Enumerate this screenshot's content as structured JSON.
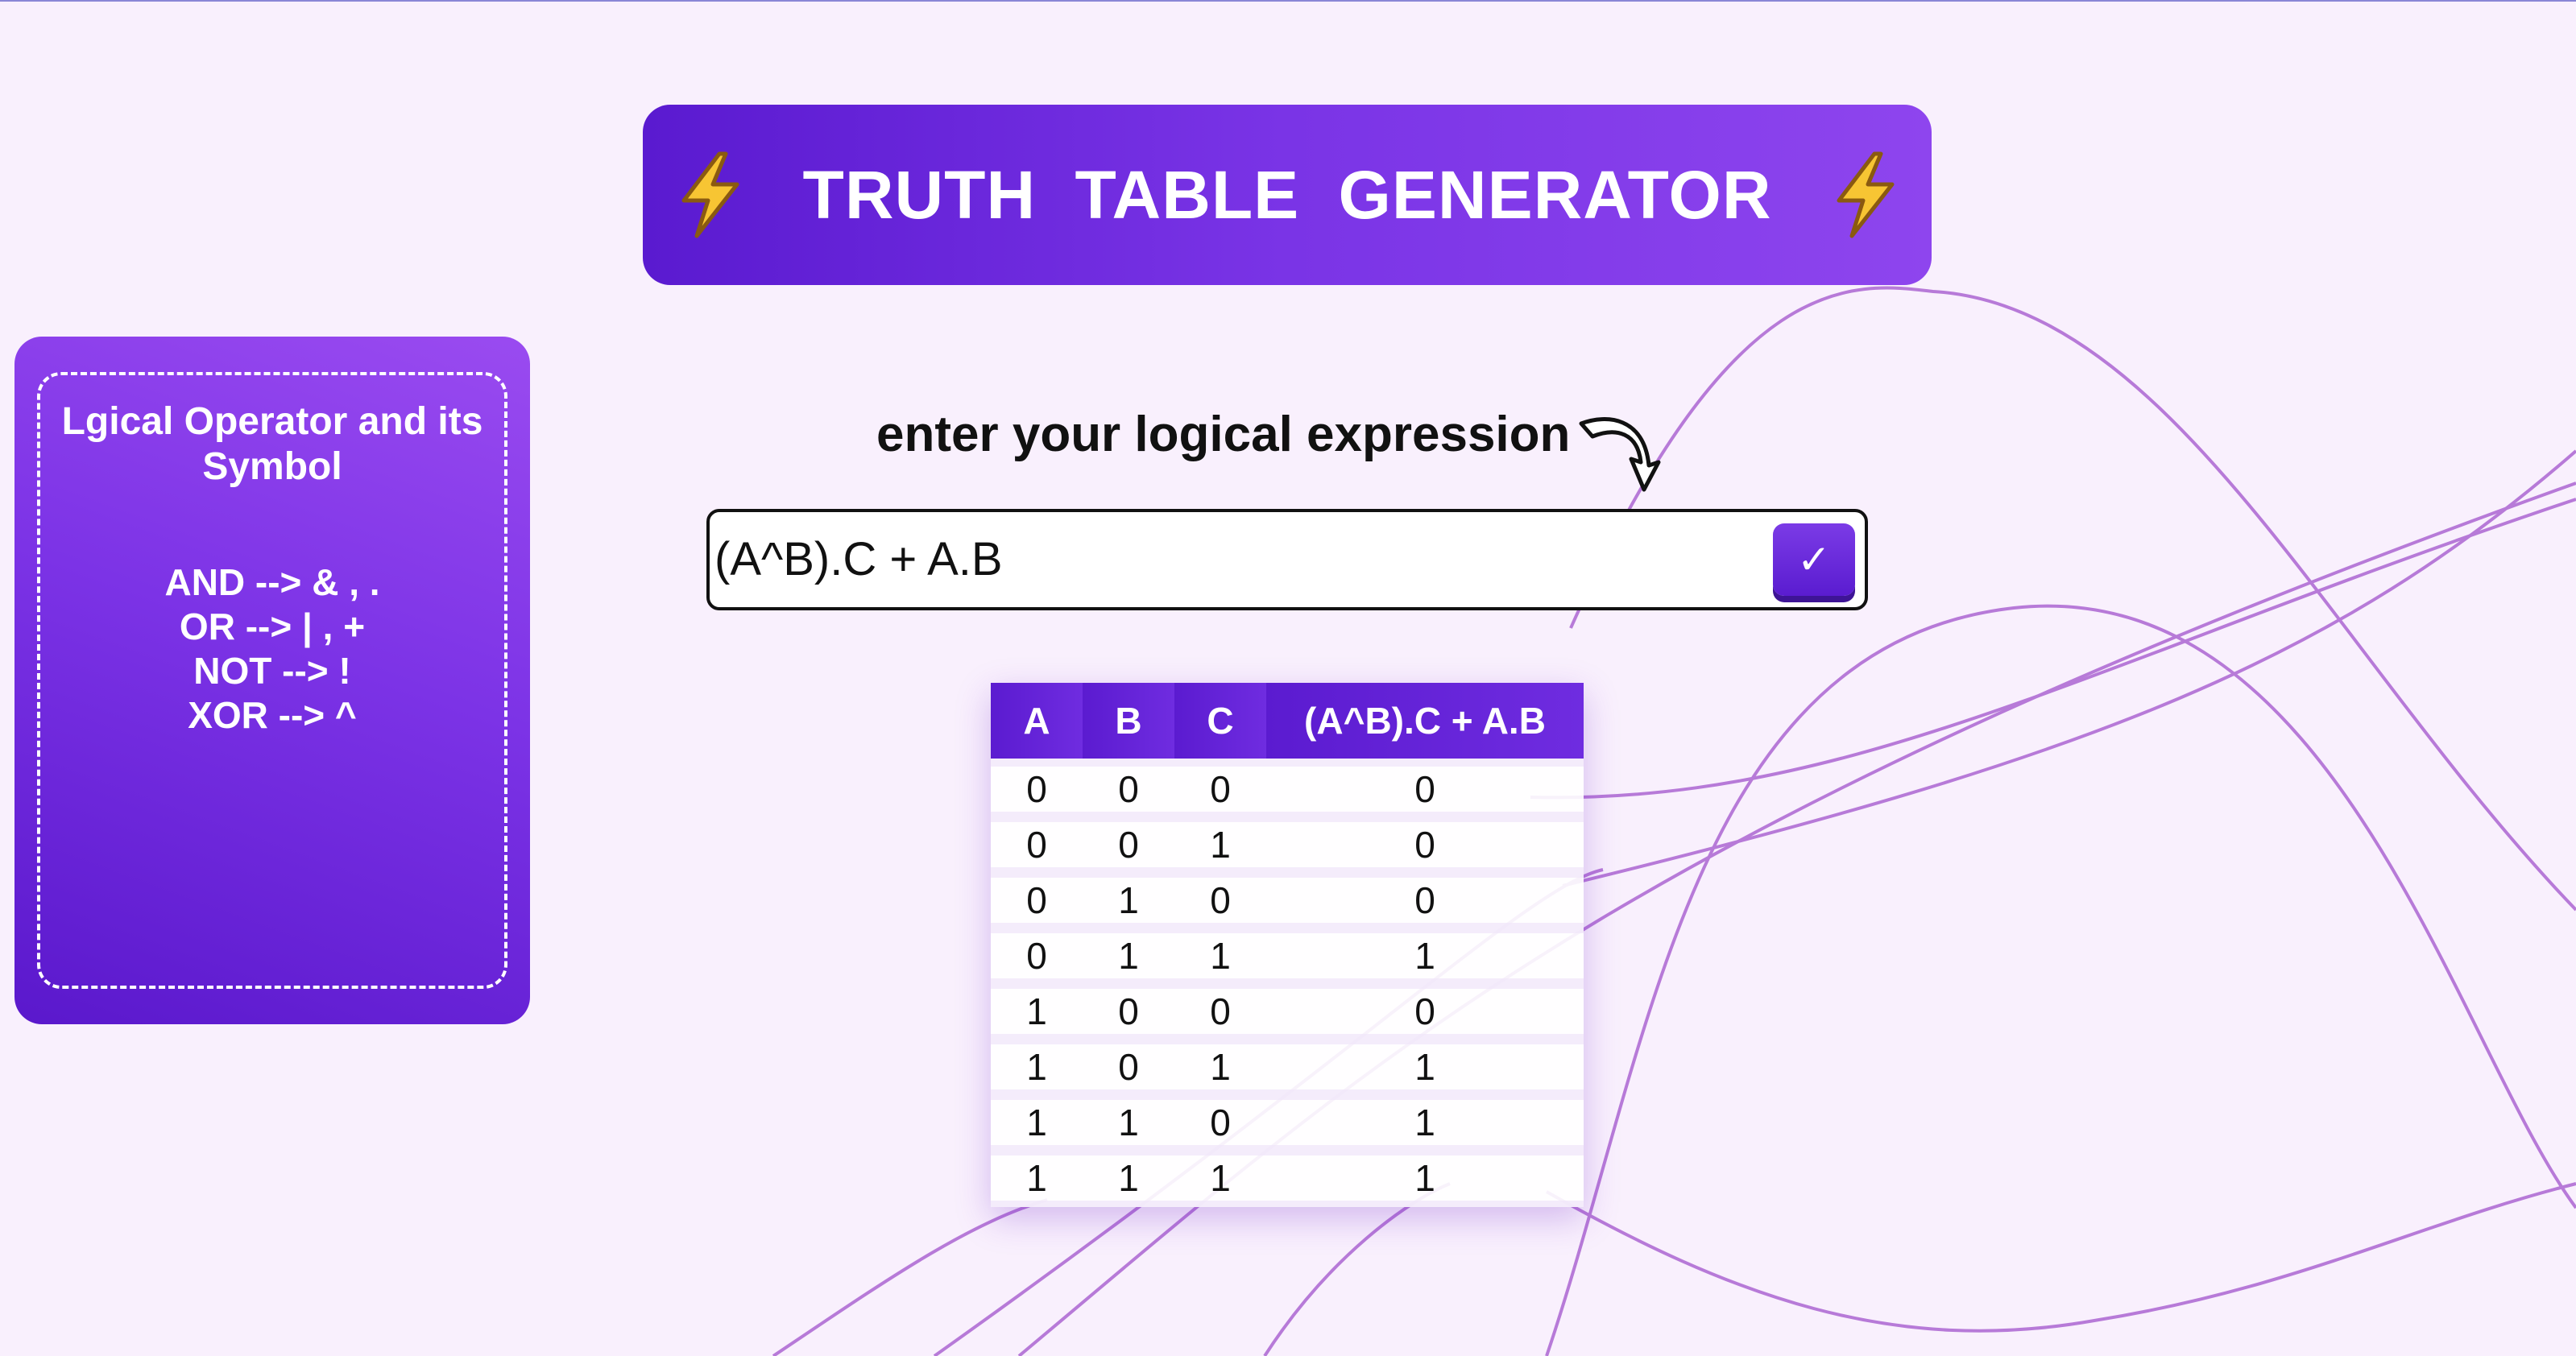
{
  "app": {
    "title": "TRUTH  TABLE  GENERATOR",
    "accent_color": "#6a24dc",
    "background_color": "#f9f0fd",
    "title_icon": "lightning-bolt-icon"
  },
  "operators_card": {
    "title": "Lgical Operator and its Symbol",
    "operators": [
      "AND --> & , .",
      "OR --> | , +",
      "NOT --> !",
      "XOR --> ^"
    ]
  },
  "expression_form": {
    "prompt_label": "enter your logical expression",
    "prompt_icon": "curved-arrow-down-icon",
    "input_value": "(A^B).C + A.B",
    "submit_label": "✓",
    "submit_icon": "checkmark-icon"
  },
  "truth_table": {
    "headers": [
      "A",
      "B",
      "C",
      "(A^B).C + A.B"
    ],
    "rows": [
      [
        "0",
        "0",
        "0",
        "0"
      ],
      [
        "0",
        "0",
        "1",
        "0"
      ],
      [
        "0",
        "1",
        "0",
        "0"
      ],
      [
        "0",
        "1",
        "1",
        "1"
      ],
      [
        "1",
        "0",
        "0",
        "0"
      ],
      [
        "1",
        "0",
        "1",
        "1"
      ],
      [
        "1",
        "1",
        "0",
        "1"
      ],
      [
        "1",
        "1",
        "1",
        "1"
      ]
    ]
  }
}
